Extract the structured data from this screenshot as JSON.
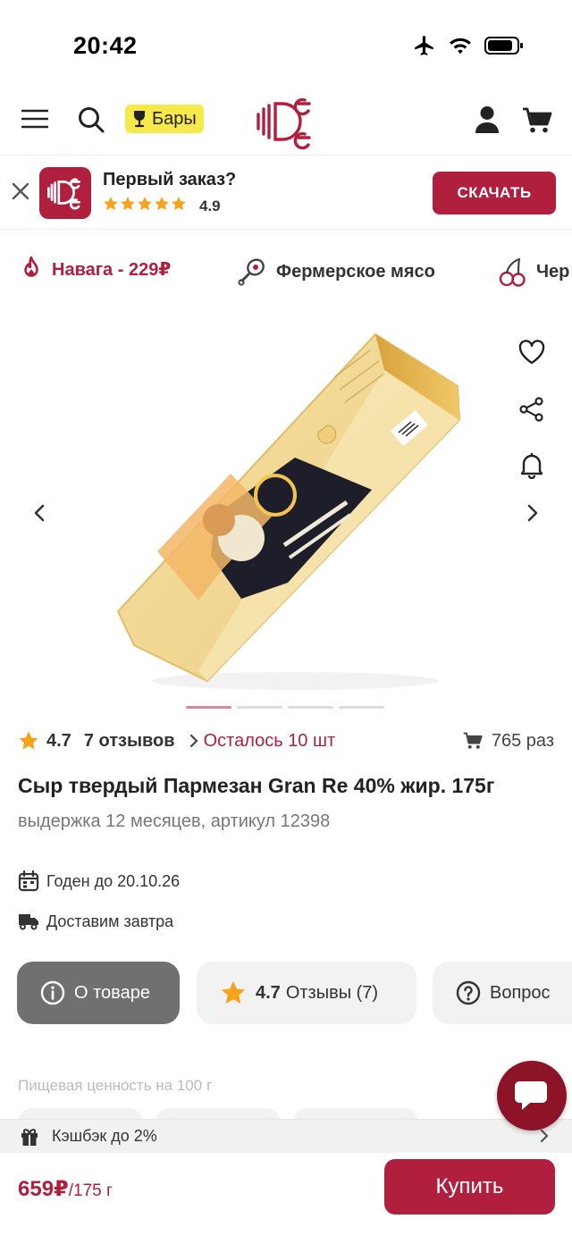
{
  "status_bar": {
    "time": "20:42"
  },
  "header": {
    "bars_label": "Бары",
    "logo_icon": "brand-logo"
  },
  "promo": {
    "title": "Первый заказ?",
    "rating": "4.9",
    "download_label": "СКАЧАТЬ"
  },
  "categories": [
    {
      "label": "Навага - 229₽",
      "icon": "fire-icon"
    },
    {
      "label": "Фермерское мясо",
      "icon": "meat-icon"
    },
    {
      "label": "Чер",
      "icon": "cherry-icon"
    }
  ],
  "product": {
    "rating": "4.7",
    "reviews": "7 отзывов",
    "remaining": "Осталось 10 шт",
    "sold": "765 раз",
    "title": "Сыр твердый Пармезан Gran Re 40% жир. 175г",
    "subtitle": "выдержка 12 месяцев, артикул 12398",
    "best_before": "Годен до 20.10.26",
    "delivery": "Доставим завтра",
    "image_pages": 4,
    "image_active_page": 1
  },
  "tabs": {
    "about": "О товаре",
    "reviews_rating": "4.7",
    "reviews": "Отзывы (7)",
    "questions": "Вопрос"
  },
  "nutrition_label": "Пищевая ценность на 100 г",
  "cashback": "Кэшбэк до 2%",
  "buy_bar": {
    "price": "659₽",
    "unit": "/175 г",
    "buy_label": "Купить"
  },
  "colors": {
    "brand": "#b01f3e",
    "star": "#f7a21b",
    "badge": "#f8e94a"
  }
}
